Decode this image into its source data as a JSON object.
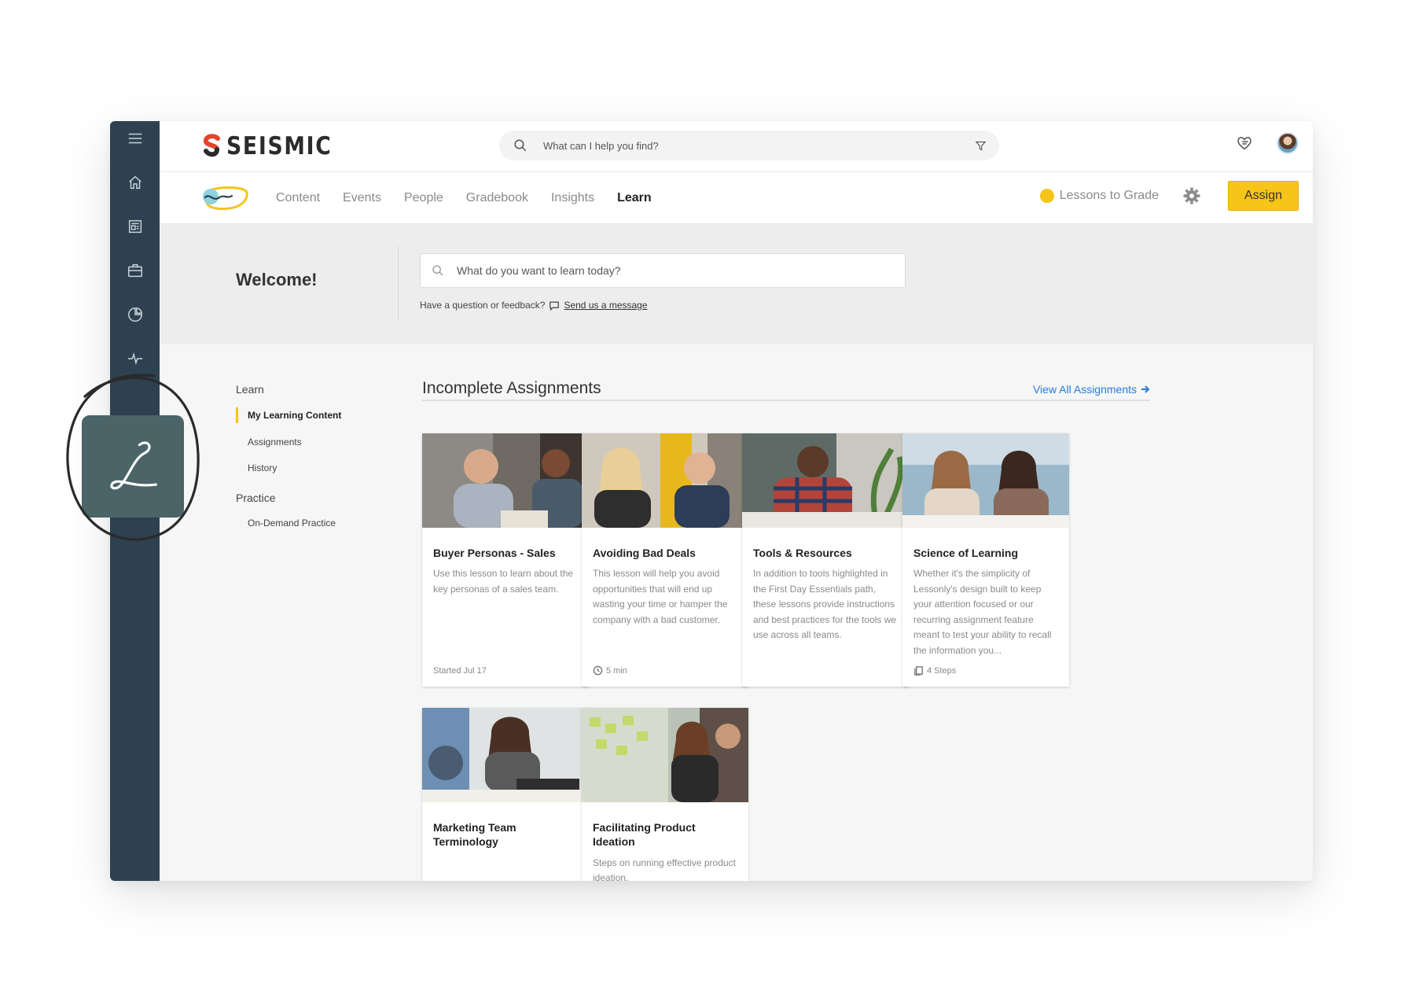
{
  "brand": {
    "name": "SEISMIC"
  },
  "topbar": {
    "search_placeholder": "What can I help you find?"
  },
  "nav": {
    "items": [
      {
        "label": "Content"
      },
      {
        "label": "Events"
      },
      {
        "label": "People"
      },
      {
        "label": "Gradebook"
      },
      {
        "label": "Insights"
      },
      {
        "label": "Learn"
      }
    ],
    "active": "Learn",
    "lessons_to_grade": "Lessons to Grade",
    "assign_label": "Assign"
  },
  "hero": {
    "welcome": "Welcome!",
    "search_placeholder": "What do you want to learn today?",
    "feedback_text": "Have a question or feedback?",
    "feedback_link": "Send us a message"
  },
  "side_nav": {
    "learn_heading": "Learn",
    "learn_items": [
      "My Learning Content",
      "Assignments",
      "History"
    ],
    "practice_heading": "Practice",
    "practice_items": [
      "On-Demand Practice"
    ]
  },
  "assignments": {
    "title": "Incomplete Assignments",
    "view_all": "View All Assignments",
    "cards": [
      {
        "title": "Buyer Personas - Sales",
        "desc": "Use this lesson to learn about the key personas of a sales team.",
        "meta": "Started Jul 17",
        "meta_icon": "none"
      },
      {
        "title": "Avoiding Bad Deals",
        "desc": "This lesson will help you avoid opportunities that will end up wasting your time or hamper the company with a bad customer.",
        "meta": "5 min",
        "meta_icon": "clock-icon"
      },
      {
        "title": "Tools & Resources",
        "desc": "In addition to tools highlighted in the First Day Essentials path, these lessons provide instructions and best practices for the tools we use across all teams.",
        "meta": "",
        "meta_icon": "none"
      },
      {
        "title": "Science of Learning",
        "desc": "Whether it's the simplicity of Lessonly's design built to keep your attention focused or our recurring assignment feature meant to test your ability to recall the information you...",
        "meta": "4 Steps",
        "meta_icon": "steps-icon"
      },
      {
        "title": "Marketing Team Terminology",
        "desc": "",
        "meta": "",
        "meta_icon": "none"
      },
      {
        "title": "Facilitating Product Ideation",
        "desc": "Steps on running effective product ideation.",
        "meta": "",
        "meta_icon": "none"
      }
    ]
  },
  "colors": {
    "rail": "#2d4150",
    "accent_yellow": "#f5c518",
    "link_blue": "#2b7bd6",
    "tile": "#4a6468"
  }
}
